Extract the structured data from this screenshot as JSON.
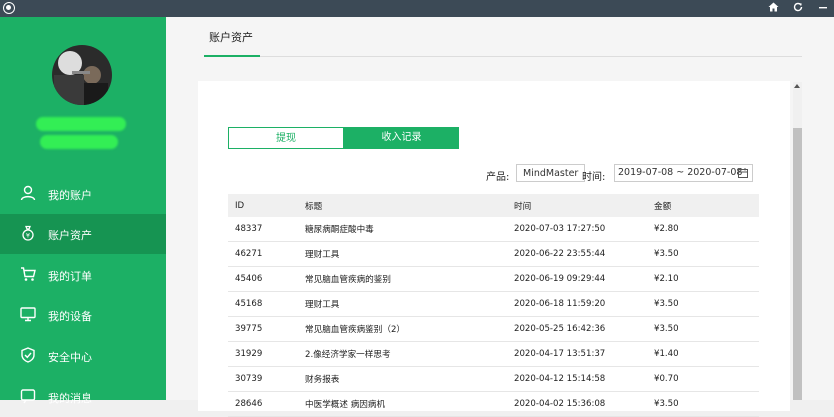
{
  "window": {
    "home_icon": "home-icon",
    "refresh_icon": "refresh-icon",
    "minimize_icon": "minimize-icon"
  },
  "sidebar": {
    "items": [
      {
        "label": "我的账户",
        "icon": "user-icon"
      },
      {
        "label": "账户资产",
        "icon": "money-bag-icon",
        "active": true
      },
      {
        "label": "我的订单",
        "icon": "cart-icon"
      },
      {
        "label": "我的设备",
        "icon": "monitor-icon"
      },
      {
        "label": "安全中心",
        "icon": "shield-icon"
      },
      {
        "label": "我的消息",
        "icon": "message-icon"
      }
    ]
  },
  "main": {
    "tab_title": "账户资产",
    "segments": {
      "withdraw": "提现",
      "income": "收入记录"
    },
    "filters": {
      "product_label": "产品:",
      "product_value": "MindMaster",
      "time_label": "时间:",
      "date_range": "2019-07-08 ~ 2020-07-08"
    },
    "table": {
      "headers": [
        "ID",
        "标题",
        "时间",
        "金额"
      ],
      "rows": [
        [
          "48337",
          "糖尿病酮症酸中毒",
          "2020-07-03 17:27:50",
          "¥2.80"
        ],
        [
          "46271",
          "理财工具",
          "2020-06-22 23:55:44",
          "¥3.50"
        ],
        [
          "45406",
          "常见脑血管疾病的鉴别",
          "2020-06-19 09:29:44",
          "¥2.10"
        ],
        [
          "45168",
          "理财工具",
          "2020-06-18 11:59:20",
          "¥3.50"
        ],
        [
          "39775",
          "常见脑血管疾病鉴别（2）",
          "2020-05-25 16:42:36",
          "¥3.50"
        ],
        [
          "31929",
          "2.像经济学家一样思考",
          "2020-04-17 13:51:37",
          "¥1.40"
        ],
        [
          "30739",
          "财务报表",
          "2020-04-12 15:14:58",
          "¥0.70"
        ],
        [
          "28646",
          "中医学概述 病因病机",
          "2020-04-02 15:36:08",
          "¥3.50"
        ]
      ]
    }
  },
  "colors": {
    "accent": "#1cb065",
    "sidebar_active": "#169452",
    "titlebar": "#3c4a56"
  }
}
